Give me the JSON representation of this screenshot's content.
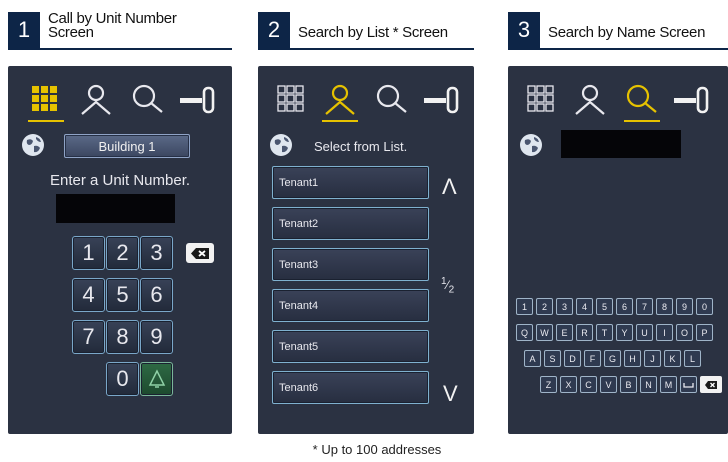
{
  "panels": [
    {
      "number": "1",
      "title_line1": "Call by Unit Number",
      "title_line2": "Screen"
    },
    {
      "number": "2",
      "title_line1": "Search by List * Screen",
      "title_line2": ""
    },
    {
      "number": "3",
      "title_line1": "Search by Name Screen",
      "title_line2": ""
    }
  ],
  "screen1": {
    "building_button": "Building 1",
    "prompt": "Enter a Unit Number.",
    "keys": [
      "1",
      "2",
      "3",
      "4",
      "5",
      "6",
      "7",
      "8",
      "9",
      "0"
    ]
  },
  "screen2": {
    "prompt": "Select from List.",
    "tenants": [
      "Tenant1",
      "Tenant2",
      "Tenant3",
      "Tenant4",
      "Tenant5",
      "Tenant6"
    ],
    "page_current": "1",
    "page_total": "2",
    "arrow_up": "Λ",
    "arrow_down": "V"
  },
  "screen3": {
    "keyboard_rows": [
      [
        "1",
        "2",
        "3",
        "4",
        "5",
        "6",
        "7",
        "8",
        "9",
        "0"
      ],
      [
        "Q",
        "W",
        "E",
        "R",
        "T",
        "Y",
        "U",
        "I",
        "O",
        "P"
      ],
      [
        "A",
        "S",
        "D",
        "F",
        "G",
        "H",
        "J",
        "K",
        "L"
      ],
      [
        "Z",
        "X",
        "C",
        "V",
        "B",
        "N",
        "M"
      ]
    ]
  },
  "footnote": "* Up to 100 addresses",
  "colors": {
    "accent": "#e6c200",
    "screen_bg": "#2b3242",
    "header_navy": "#0d2547"
  }
}
